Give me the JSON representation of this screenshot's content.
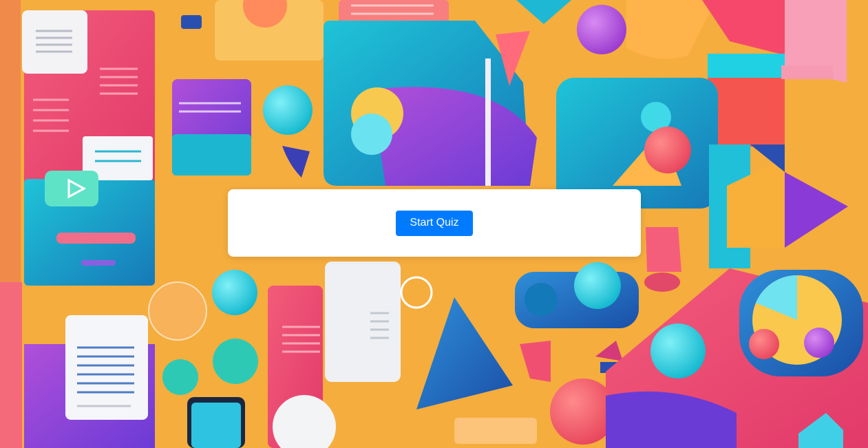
{
  "quiz": {
    "start_label": "Start Quiz"
  },
  "colors": {
    "background": "#f4a93a",
    "button": "#007bff",
    "button_text": "#ffffff",
    "card": "#ffffff"
  },
  "background_image": {
    "icon": "abstract-education-illustration"
  }
}
